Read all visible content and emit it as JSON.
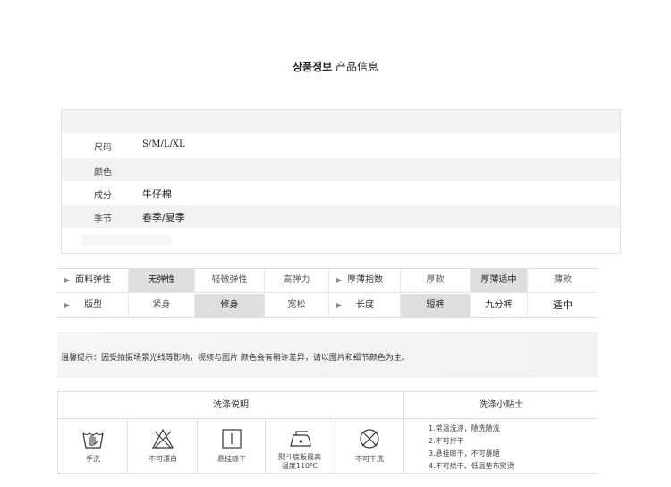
{
  "header": {
    "title_bold": "상품정보",
    "title_rest": " 产品信息"
  },
  "info": {
    "rows": [
      {
        "label": "尺码",
        "value": "S/M/L/XL"
      },
      {
        "label": "颜色",
        "value": ""
      },
      {
        "label": "成分",
        "value": "牛仔棉"
      },
      {
        "label": "季节",
        "value": "春季/夏季"
      }
    ]
  },
  "attributes": {
    "row1": {
      "head1": "面料弹性",
      "opts1": [
        "无弹性",
        "轻微弹性",
        "高弹力"
      ],
      "selected1": "无弹性",
      "head2": "厚薄指数",
      "opts2": [
        "厚款",
        "厚薄适中",
        "薄款"
      ],
      "selected2": "厚薄适中"
    },
    "row2": {
      "head1": "版型",
      "opts1": [
        "紧身",
        "修身",
        "宽松"
      ],
      "selected1": "修身",
      "head2": "长度",
      "opts2": [
        "短裤",
        "九分裤",
        "适中"
      ],
      "selected2": "短裤"
    }
  },
  "notice": {
    "text": "温馨提示：因受拍摄场景光线等影响，视频与图片 颜色会有稍许差异，请以图片和细节颜色为主。"
  },
  "care": {
    "header_left": "洗涤说明",
    "header_right": "洗涤小贴士",
    "icons": [
      {
        "icon": "hand-wash-icon",
        "caption": "手洗"
      },
      {
        "icon": "no-bleach-icon",
        "caption": "不可漂白"
      },
      {
        "icon": "hang-dry-icon",
        "caption": "悬挂晾干"
      },
      {
        "icon": "iron-icon",
        "caption": "熨斗底板最高",
        "caption2": "温度110℃"
      },
      {
        "icon": "no-tumble-dry-icon",
        "caption": "不可干洗"
      }
    ],
    "tips": [
      "1.常温洗涤，随洗随洗",
      "2.不可拧干",
      "3.悬挂晾干，不可暴晒",
      "4.不可烘干、低温垫布熨烫"
    ]
  }
}
